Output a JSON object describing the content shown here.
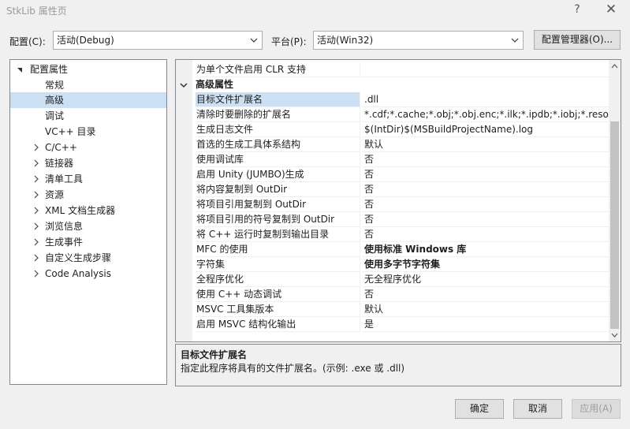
{
  "window": {
    "title": "StkLib 属性页",
    "help_label": "?",
    "close_label": "✕"
  },
  "config": {
    "config_label": "配置(C):",
    "config_value": "活动(Debug)",
    "platform_label": "平台(P):",
    "platform_value": "活动(Win32)",
    "manager_label": "配置管理器(O)..."
  },
  "tree": {
    "root": "配置属性",
    "items": [
      {
        "label": "常规"
      },
      {
        "label": "高级"
      },
      {
        "label": "调试"
      },
      {
        "label": "VC++ 目录"
      },
      {
        "label": "C/C++"
      },
      {
        "label": "链接器"
      },
      {
        "label": "清单工具"
      },
      {
        "label": "资源"
      },
      {
        "label": "XML 文档生成器"
      },
      {
        "label": "浏览信息"
      },
      {
        "label": "生成事件"
      },
      {
        "label": "自定义生成步骤"
      },
      {
        "label": "Code Analysis"
      }
    ],
    "selected": "高级"
  },
  "grid": {
    "top_row": {
      "name": "为单个文件启用 CLR 支持",
      "value": ""
    },
    "category": "高级属性",
    "rows": [
      {
        "name": "目标文件扩展名",
        "value": ".dll"
      },
      {
        "name": "清除时要删除的扩展名",
        "value": "*.cdf;*.cache;*.obj;*.obj.enc;*.ilk;*.ipdb;*.iobj;*.resource"
      },
      {
        "name": "生成日志文件",
        "value": "$(IntDir)$(MSBuildProjectName).log"
      },
      {
        "name": "首选的生成工具体系结构",
        "value": "默认"
      },
      {
        "name": "使用调试库",
        "value": "否"
      },
      {
        "name": "启用 Unity (JUMBO)生成",
        "value": "否"
      },
      {
        "name": "将内容复制到 OutDir",
        "value": "否"
      },
      {
        "name": "将项目引用复制到 OutDir",
        "value": "否"
      },
      {
        "name": "将项目引用的符号复制到 OutDir",
        "value": "否"
      },
      {
        "name": "将 C++ 运行时复制到输出目录",
        "value": "否"
      },
      {
        "name": "MFC 的使用",
        "value": "使用标准 Windows 库"
      },
      {
        "name": "字符集",
        "value": "使用多字节字符集"
      },
      {
        "name": "全程序优化",
        "value": "无全程序优化"
      },
      {
        "name": "使用 C++ 动态调试",
        "value": "否"
      },
      {
        "name": "MSVC 工具集版本",
        "value": "默认"
      },
      {
        "name": "启用 MSVC 结构化输出",
        "value": "是"
      }
    ]
  },
  "description": {
    "title": "目标文件扩展名",
    "text": "指定此程序将具有的文件扩展名。(示例: .exe 或 .dll)"
  },
  "buttons": {
    "ok": "确定",
    "cancel": "取消",
    "apply": "应用(A)"
  }
}
